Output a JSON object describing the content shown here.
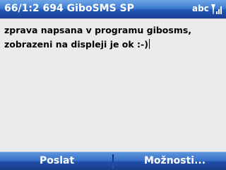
{
  "titlebar": {
    "title": "66/1:2 694  GiboSMS SP",
    "input_mode": "abc",
    "signal_icon": "signal-strength-icon"
  },
  "editor": {
    "text": "zprava napsana v programu gibosms, zobrazeni na displeji je ok :-)"
  },
  "softkeys": {
    "left_label": "Poslat",
    "right_label": "Možnosti..."
  },
  "colors": {
    "bar_blue": "#2356b4",
    "content_bg": "#ebebeb",
    "text": "#000000"
  }
}
